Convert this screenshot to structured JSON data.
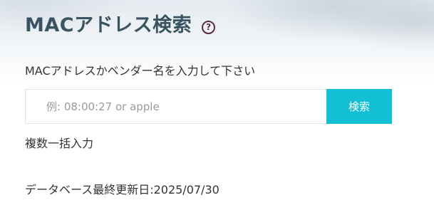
{
  "header": {
    "title": "MACアドレス検索",
    "help_icon": "question-circle-icon",
    "help_glyph": "?"
  },
  "search": {
    "instruction": "MACアドレスかベンダー名を入力して下さい",
    "placeholder": "例: 08:00:27 or apple",
    "value": "",
    "button_label": "検索"
  },
  "bulk_input": {
    "label": "複数一括入力"
  },
  "database": {
    "updated_text": "データベース最終更新日:2025/07/30"
  },
  "colors": {
    "title": "#3a5360",
    "button": "#12bfd3",
    "help_icon": "#5a2a45"
  }
}
